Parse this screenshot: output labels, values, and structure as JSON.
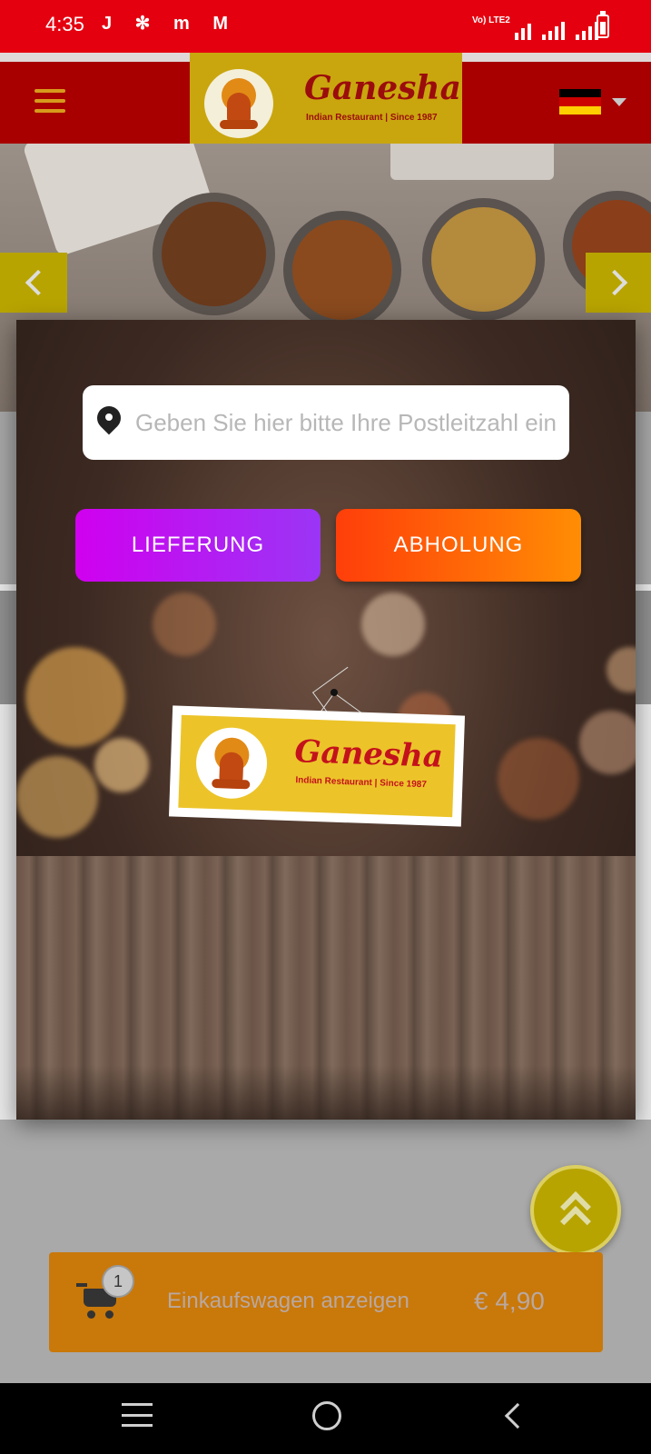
{
  "status_bar": {
    "time": "4:35",
    "notification_icons": "J ✻ m M",
    "network_label": "Vo) LTE2"
  },
  "header": {
    "logo_title": "Ganesha",
    "logo_subtitle": "Indian Restaurant | Since 1987",
    "language": "de-flag-icon"
  },
  "modal": {
    "zip_placeholder": "Geben Sie hier bitte Ihre Postleitzahl ein",
    "delivery_label": "LIEFERUNG",
    "pickup_label": "ABHOLUNG",
    "sign_title": "Ganesha",
    "sign_subtitle": "Indian Restaurant | Since 1987"
  },
  "cart": {
    "count": "1",
    "label": "Einkaufswagen anzeigen",
    "price": "€ 4,90"
  },
  "colors": {
    "status_bar": "#e50010",
    "header": "#a80000",
    "delivery_button": "#c000f0",
    "pickup_button": "#ff5a08",
    "cart_bar": "#c9780a"
  }
}
